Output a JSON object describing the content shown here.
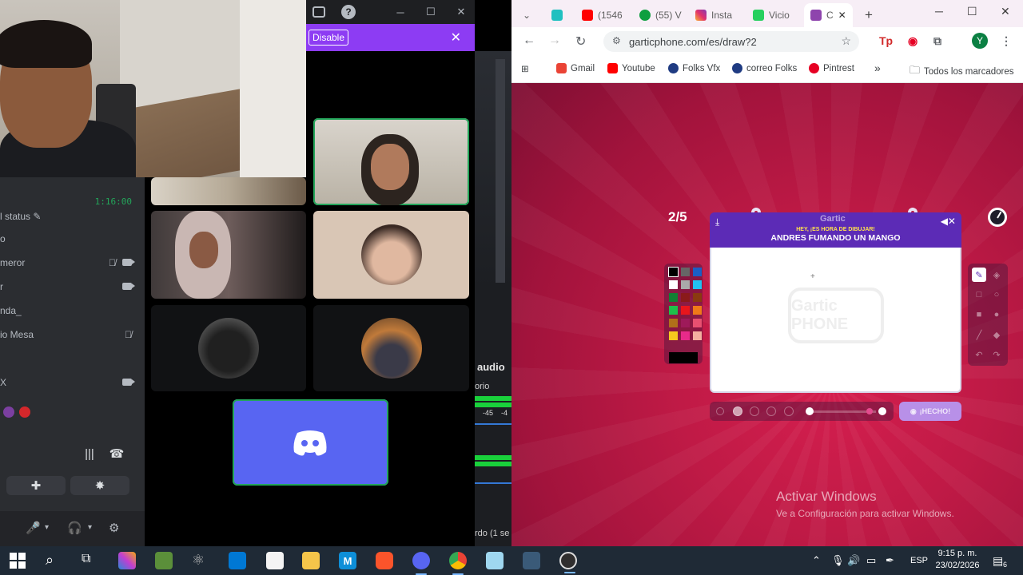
{
  "discord": {
    "titlebar": {
      "inbox_icon": "inbox-icon",
      "help_label": "?",
      "min": "─",
      "max": "☐",
      "close": "✕"
    },
    "notice": {
      "disable_label": "Disable",
      "close_label": "✕"
    },
    "sidebar": {
      "timer": "1:16:00",
      "rows": [
        {
          "label": "l status ✎"
        },
        {
          "label": "o"
        },
        {
          "label": "meror"
        },
        {
          "label": "r"
        },
        {
          "label": "nda_"
        },
        {
          "label": "io Mesa"
        },
        {
          "label": ""
        },
        {
          "label": "X"
        }
      ]
    }
  },
  "obs": {
    "audio_label": "audio",
    "rio_label": "orio",
    "db_left": "-45",
    "db_right": "-4",
    "bottom_text": "rdo (1 se"
  },
  "browser": {
    "tabs": [
      {
        "label": ""
      },
      {
        "label": ""
      },
      {
        "label": "(1546"
      },
      {
        "label": "(55) V"
      },
      {
        "label": "Insta"
      },
      {
        "label": "Vicio"
      },
      {
        "label": "C"
      }
    ],
    "url": "garticphone.com/es/draw?2",
    "bookmarks": [
      {
        "label": "Gmail",
        "color": "#ea4335"
      },
      {
        "label": "Youtube",
        "color": "#ff0000"
      },
      {
        "label": "Folks Vfx",
        "color": "#1f3b82"
      },
      {
        "label": "correo Folks",
        "color": "#1f3b82"
      },
      {
        "label": "Pintrest",
        "color": "#e60023"
      }
    ],
    "more_bookmarks": "»",
    "all_bookmarks": "Todos los marcadores",
    "profile_initial": "Y"
  },
  "game": {
    "round": "2/5",
    "logo": "Gartic",
    "subtitle": "HEY, ¡ES HORA DE DIBUJAR!",
    "prompt": "ANDRES FUMANDO UN MANGO",
    "watermark": "Gartic PHONE",
    "done_label": "¡HECHO!",
    "palette": [
      "#000000",
      "#666666",
      "#1a5ec4",
      "#ffffff",
      "#aaaaaa",
      "#22c0f0",
      "#118033",
      "#8a1a1a",
      "#8a3a10",
      "#1ec04a",
      "#e8161c",
      "#f07a18",
      "#b0701a",
      "#9e1a5a",
      "#e85070",
      "#f6c81e",
      "#e82a8a",
      "#f4b0a0"
    ],
    "brush_color": "#000000"
  },
  "watermark": {
    "line1": "Activar Windows",
    "line2": "Ve a Configuración para activar Windows."
  },
  "taskbar": {
    "lang": "ESP",
    "time": "9:15 p. m.",
    "date": "23/02/2026",
    "notif_count": "6"
  }
}
